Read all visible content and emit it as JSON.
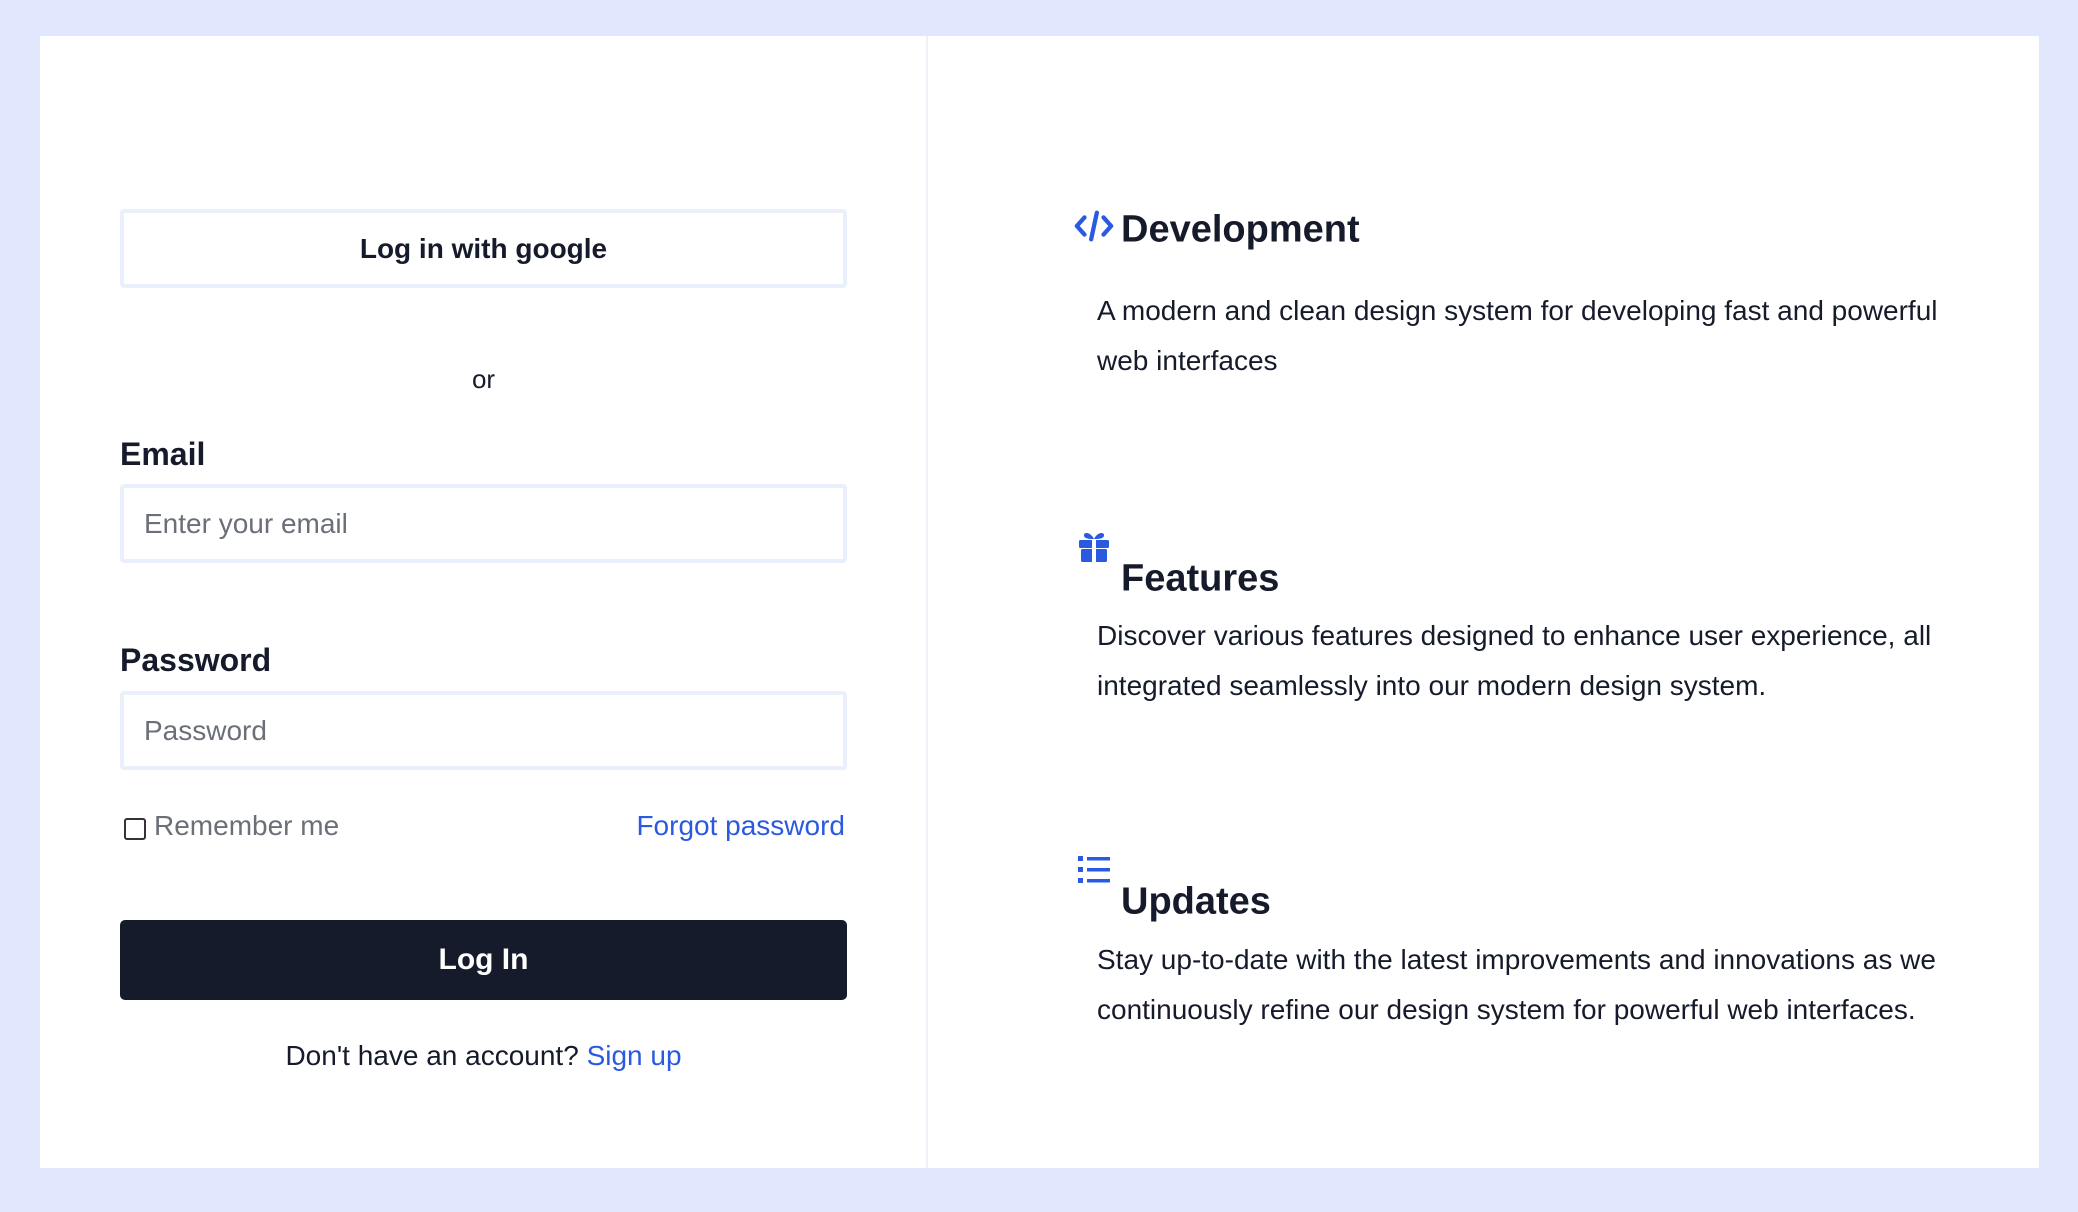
{
  "login": {
    "google_button": "Log in with google",
    "or_text": "or",
    "email_label": "Email",
    "email_placeholder": "Enter your email",
    "email_value": "",
    "password_label": "Password",
    "password_placeholder": "Password",
    "password_value": "",
    "remember_label": "Remember me",
    "remember_checked": false,
    "forgot_link": "Forgot password",
    "submit_button": "Log In",
    "signup_prompt": "Don't have an account?",
    "signup_link": "Sign up"
  },
  "features": [
    {
      "icon": "code-icon",
      "title": "Development",
      "description": "A modern and clean design system for developing fast and powerful web interfaces"
    },
    {
      "icon": "gift-icon",
      "title": "Features",
      "description": "Discover various features designed to enhance user experience, all integrated seamlessly into our modern design system."
    },
    {
      "icon": "list-icon",
      "title": "Updates",
      "description": "Stay up-to-date with the latest improvements and innovations as we continuously refine our design system for powerful web interfaces."
    }
  ],
  "colors": {
    "page_background": "#e1e7fd",
    "card_background": "#ffffff",
    "primary_dark": "#161b2b",
    "accent_blue": "#2a5ae0",
    "input_border": "#eaf0fb"
  }
}
